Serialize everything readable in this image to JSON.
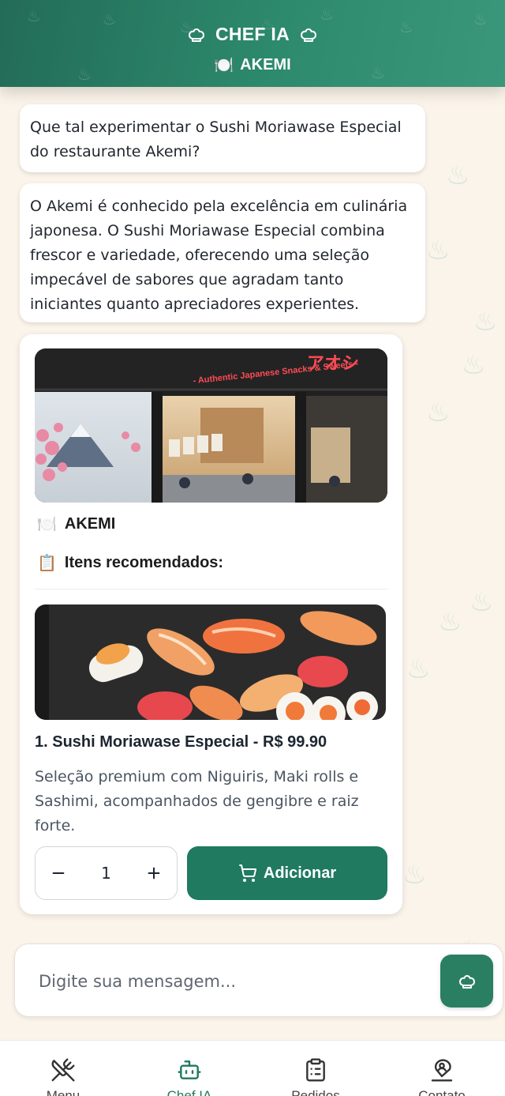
{
  "header": {
    "title": "CHEF IA",
    "restaurant_emoji": "🍽️",
    "restaurant": "AKEMI"
  },
  "messages": [
    {
      "text": "Que tal experimentar o Sushi Moriawase Especial do restaurante Akemi?"
    },
    {
      "text": "O Akemi é conhecido pela excelência em culinária japonesa. O Sushi Moriawase Especial combina frescor e variedade, oferecendo uma seleção impecável de sabores que agradam tanto iniciantes quanto apreciadores experientes."
    }
  ],
  "card": {
    "storefront_sign": "- Authentic Japanese Snacks & Sweets -",
    "storefront_sign_jp": "アオシ",
    "restaurant_emoji": "🍽️",
    "restaurant": "AKEMI",
    "items_emoji": "📋",
    "items_heading": "Itens recomendados:",
    "dish": {
      "title": "1. Sushi Moriawase Especial - R$ 99.90",
      "description": "Seleção premium com Niguiris, Maki rolls e Sashimi, acompanhados de gengibre e raiz forte.",
      "quantity": "1",
      "add_label": "Adicionar"
    }
  },
  "input": {
    "placeholder": "Digite sua mensagem..."
  },
  "nav": {
    "items": [
      {
        "label": "Menu",
        "icon": "utensils-crossed-icon"
      },
      {
        "label": "Chef IA",
        "icon": "robot-icon",
        "active": true
      },
      {
        "label": "Pedidos",
        "icon": "clipboard-list-icon"
      },
      {
        "label": "Contato",
        "icon": "map-pin-user-icon"
      }
    ]
  },
  "colors": {
    "primary": "#1f7a5f",
    "header": "#2d8a6c",
    "background": "#fbf4ea"
  }
}
